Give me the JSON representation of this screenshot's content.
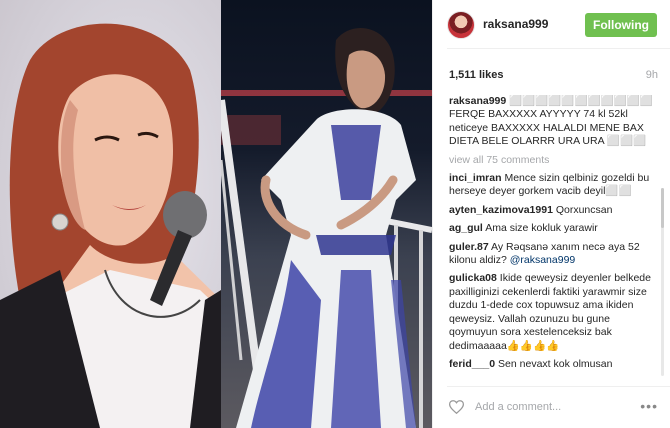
{
  "post": {
    "username": "raksana999",
    "follow_label": "Following",
    "likes": "1,511 likes",
    "time": "9h",
    "caption_user": "raksana999",
    "caption_text": "⬜⬜⬜⬜⬜⬜⬜⬜⬜⬜⬜ FERQE BAXXXXX AYYYYY 74 kl 52kl neticeye BAXXXXX HALALDI MENE BAX DIETA BELE OLARRR URA URA ⬜⬜⬜",
    "view_all": "view all 75 comments"
  },
  "comments": [
    {
      "user": "inci_imran",
      "text": "Mence sizin qelbiniz gozeldi bu herseye deyer gorkem vacib deyil⬜⬜"
    },
    {
      "user": "ayten_kazimova1991",
      "text": "Qorxuncsan"
    },
    {
      "user": "ag_gul",
      "text": "Ama size kokluk yarawir"
    },
    {
      "user": "guler.87",
      "text": "Ay Rəqsanə xanım necə aya 52 kilonu aldiz?",
      "mention": "@raksana999"
    },
    {
      "user": "gulicka08",
      "text": "Ikide qeweysiz deyenler belkede paxilliginizi cekenlerdi faktiki yarawmir size duzdu 1-dede cox topuwsuz ama ikiden qeweysiz. Vallah ozunuzu bu gune qoymuyun sora xestelenceksiz bak dedimaaaaa👍👍👍👍"
    },
    {
      "user": "ferid___0",
      "text": "Sen nevaxt kok olmusan"
    }
  ],
  "footer": {
    "comment_placeholder": "Add a comment...",
    "more_label": "•••"
  },
  "colors": {
    "follow_button": "#70c050",
    "mention": "#003569",
    "muted": "#a5a7aa"
  },
  "icons": [
    "heart-icon",
    "more-options-icon"
  ]
}
